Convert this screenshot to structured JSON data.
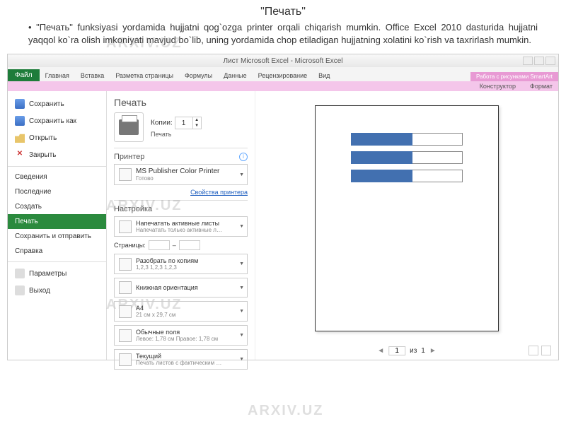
{
  "slide": {
    "title": "\"Печать\"",
    "body": "• \"Печать\" funksiyasi yordamida hujjatni qog`ozga printer orqali chiqarish mumkin. Office Excel 2010 dasturida hujjatni yaqqol ko`ra olish imkoniyati mavjud bo`lib, uning yordamida chop etiladigan hujjatning xolatini ko`rish va taxrirlash mumkin."
  },
  "watermark": "ARXIV.UZ",
  "window": {
    "title": "Лист Microsoft Excel - Microsoft Excel",
    "contextGroup": "Работа с рисунками SmartArt",
    "contextTabs": {
      "a": "Конструктор",
      "b": "Формат"
    },
    "tabs": {
      "file": "Файл",
      "home": "Главная",
      "insert": "Вставка",
      "layout": "Разметка страницы",
      "formulas": "Формулы",
      "data": "Данные",
      "review": "Рецензирование",
      "view": "Вид"
    }
  },
  "sidebar": {
    "save": "Сохранить",
    "saveAs": "Сохранить как",
    "open": "Открыть",
    "close": "Закрыть",
    "info": "Сведения",
    "recent": "Последние",
    "new": "Создать",
    "print": "Печать",
    "share": "Сохранить и отправить",
    "help": "Справка",
    "options": "Параметры",
    "exit": "Выход"
  },
  "print": {
    "heading": "Печать",
    "button": "Печать",
    "copiesLabel": "Копии:",
    "copiesValue": "1",
    "printerHeading": "Принтер",
    "printerName": "MS Publisher Color Printer",
    "printerStatus": "Готово",
    "printerProps": "Свойства принтера",
    "settingsHeading": "Настройка",
    "activeSheets": "Напечатать активные листы",
    "activeSheetsSub": "Напечатать только активные л…",
    "pagesLabel": "Страницы:",
    "pagesTo": "–",
    "collate": "Разобрать по копиям",
    "collateSub": "1,2,3  1,2,3  1,2,3",
    "orientation": "Книжная ориентация",
    "paperSize": "A4",
    "paperSizeSub": "21 см x 29,7 см",
    "margins": "Обычные поля",
    "marginsSub": "Левое: 1,78 см  Правое: 1,78 см",
    "scaling": "Текущий",
    "scalingSub": "Печать листов с фактическим …"
  },
  "pager": {
    "current": "1",
    "of": "из",
    "total": "1"
  }
}
